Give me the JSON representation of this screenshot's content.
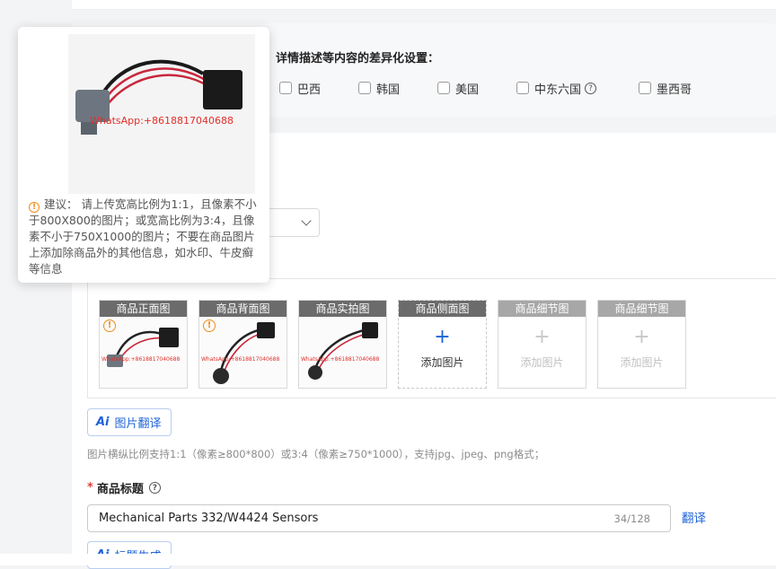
{
  "market_settings": {
    "heading": "详情描述等内容的差异化设置：",
    "options": [
      {
        "label": "巴西",
        "checked": false
      },
      {
        "label": "韩国",
        "checked": false
      },
      {
        "label": "美国",
        "checked": false
      },
      {
        "label": "中东六国",
        "checked": false,
        "help": "?"
      },
      {
        "label": "墨西哥",
        "checked": false
      }
    ]
  },
  "tooltip": {
    "image_watermark": "WhatsApp:+8618817040688",
    "warning_icon": "!",
    "text": "建议： 请上传宽高比例为1:1，且像素不小于800X800的图片；或宽高比例为3:4，且像素不小于750X1000的图片；不要在商品图片上添加除商品外的其他信息，如水印、牛皮癣等信息"
  },
  "image_slots": [
    {
      "title": "商品正面图",
      "has_image": true,
      "watermark": "WhatsApp:+8618817040688",
      "warning": "!"
    },
    {
      "title": "商品背面图",
      "has_image": true,
      "watermark": "WhatsApp:+8618817040688",
      "warning": "!"
    },
    {
      "title": "商品实拍图",
      "has_image": true,
      "watermark": "WhatsApp:+8618817040688",
      "warning": "!"
    },
    {
      "title": "商品侧面图",
      "has_image": false,
      "plus": "+",
      "add_label": "添加图片",
      "enabled": true
    },
    {
      "title": "商品细节图",
      "has_image": false,
      "plus": "+",
      "add_label": "添加图片",
      "enabled": false
    },
    {
      "title": "商品细节图",
      "has_image": false,
      "plus": "+",
      "add_label": "添加图片",
      "enabled": false
    }
  ],
  "image_translate_button": {
    "ai_mark": "Ai",
    "label": "图片翻译"
  },
  "image_hint": "图片横纵比例支持1:1（像素≥800*800）或3:4（像素≥750*1000），支持jpg、jpeg、png格式；",
  "product_title": {
    "required_mark": "*",
    "label": "商品标题",
    "help": "?",
    "value": "Mechanical Parts 332/W4424 Sensors",
    "count": "34/128",
    "translate": "翻译"
  },
  "title_generate_button": {
    "ai_mark": "Ai",
    "label": "标题生成"
  },
  "colors": {
    "accent": "#1f63d8",
    "warning": "#f08c1a",
    "required": "#e23c3c",
    "slot_header": "#6b6b6b"
  }
}
